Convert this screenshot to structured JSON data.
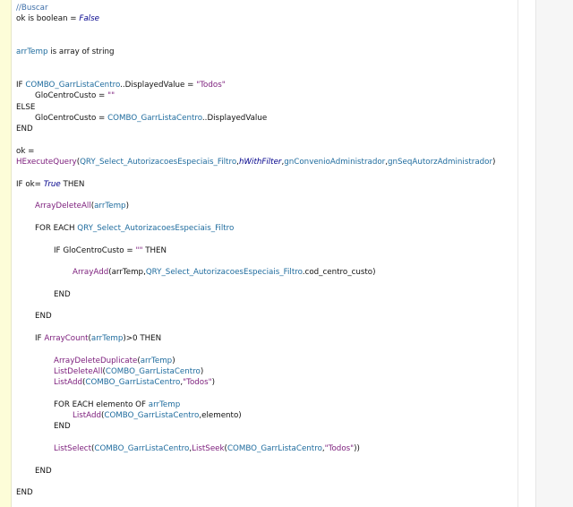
{
  "colors": {
    "keyword": "#1a1a1a",
    "comment": "#3d6ea8",
    "boolean": "#00008b",
    "function": "#7b1c7b",
    "control": "#1f6c9e",
    "string": "#7b1c7b",
    "default": "#111111"
  },
  "code_lines": [
    {
      "row": 0,
      "indent": 0,
      "tokens": [
        {
          "t": "//Buscar",
          "c": "comment"
        }
      ]
    },
    {
      "row": 1,
      "indent": 0,
      "tokens": [
        {
          "t": "ok is boolean = ",
          "c": "default"
        },
        {
          "t": "False",
          "c": "boolean",
          "i": true
        }
      ]
    },
    {
      "row": 4,
      "indent": 0,
      "tokens": [
        {
          "t": "arrTemp",
          "c": "control"
        },
        {
          "t": " is array of string",
          "c": "default"
        }
      ]
    },
    {
      "row": 7,
      "indent": 0,
      "tokens": [
        {
          "t": "IF ",
          "c": "default"
        },
        {
          "t": "COMBO_GarrListaCentro",
          "c": "control"
        },
        {
          "t": "..DisplayedValue = ",
          "c": "default"
        },
        {
          "t": "\"Todos\"",
          "c": "string"
        }
      ]
    },
    {
      "row": 8,
      "indent": 1,
      "tokens": [
        {
          "t": "GloCentroCusto = ",
          "c": "default"
        },
        {
          "t": "\"\"",
          "c": "string"
        }
      ]
    },
    {
      "row": 9,
      "indent": 0,
      "tokens": [
        {
          "t": "ELSE",
          "c": "default"
        }
      ]
    },
    {
      "row": 10,
      "indent": 1,
      "tokens": [
        {
          "t": "GloCentroCusto = ",
          "c": "default"
        },
        {
          "t": "COMBO_GarrListaCentro",
          "c": "control"
        },
        {
          "t": "..DisplayedValue",
          "c": "default"
        }
      ]
    },
    {
      "row": 11,
      "indent": 0,
      "tokens": [
        {
          "t": "END",
          "c": "default"
        }
      ]
    },
    {
      "row": 13,
      "indent": 0,
      "tokens": [
        {
          "t": "ok =",
          "c": "default"
        }
      ]
    },
    {
      "row": 14,
      "indent": 0,
      "tokens": [
        {
          "t": "HExecuteQuery",
          "c": "function"
        },
        {
          "t": "(",
          "c": "default"
        },
        {
          "t": "QRY_Select_AutorizacoesEspeciais_Filtro",
          "c": "control"
        },
        {
          "t": ",",
          "c": "default"
        },
        {
          "t": "hWithFilter",
          "c": "boolean",
          "i": true
        },
        {
          "t": ",",
          "c": "default"
        },
        {
          "t": "gnConvenioAdministrador",
          "c": "control"
        },
        {
          "t": ",",
          "c": "default"
        },
        {
          "t": "gnSeqAutorzAdministrador",
          "c": "control"
        },
        {
          "t": ")",
          "c": "default"
        }
      ]
    },
    {
      "row": 16,
      "indent": 0,
      "tokens": [
        {
          "t": "IF ok= ",
          "c": "default"
        },
        {
          "t": "True",
          "c": "boolean",
          "i": true
        },
        {
          "t": " THEN",
          "c": "default"
        }
      ]
    },
    {
      "row": 18,
      "indent": 1,
      "tokens": [
        {
          "t": "ArrayDeleteAll",
          "c": "function"
        },
        {
          "t": "(",
          "c": "default"
        },
        {
          "t": "arrTemp",
          "c": "control"
        },
        {
          "t": ")",
          "c": "default"
        }
      ]
    },
    {
      "row": 20,
      "indent": 1,
      "tokens": [
        {
          "t": "FOR EACH ",
          "c": "default"
        },
        {
          "t": "QRY_Select_AutorizacoesEspeciais_Filtro",
          "c": "control"
        }
      ]
    },
    {
      "row": 22,
      "indent": 2,
      "tokens": [
        {
          "t": "IF ",
          "c": "default"
        },
        {
          "t": "GloCentroCusto",
          "c": "default"
        },
        {
          "t": " = ",
          "c": "default"
        },
        {
          "t": "\"\"",
          "c": "string"
        },
        {
          "t": " THEN",
          "c": "default"
        }
      ]
    },
    {
      "row": 24,
      "indent": 3,
      "tokens": [
        {
          "t": "ArrayAdd",
          "c": "function"
        },
        {
          "t": "(",
          "c": "default"
        },
        {
          "t": "arrTemp",
          "c": "default"
        },
        {
          "t": ",",
          "c": "default"
        },
        {
          "t": "QRY_Select_AutorizacoesEspeciais_Filtro",
          "c": "control"
        },
        {
          "t": ".cod_centro_custo)",
          "c": "default"
        }
      ]
    },
    {
      "row": 26,
      "indent": 2,
      "tokens": [
        {
          "t": "END",
          "c": "default"
        }
      ]
    },
    {
      "row": 28,
      "indent": 1,
      "tokens": [
        {
          "t": "END",
          "c": "default"
        }
      ]
    },
    {
      "row": 30,
      "indent": 1,
      "tokens": [
        {
          "t": "IF ",
          "c": "default"
        },
        {
          "t": "ArrayCount",
          "c": "function"
        },
        {
          "t": "(",
          "c": "default"
        },
        {
          "t": "arrTemp",
          "c": "control"
        },
        {
          "t": ")>0 THEN",
          "c": "default"
        }
      ]
    },
    {
      "row": 32,
      "indent": 2,
      "tokens": [
        {
          "t": "ArrayDeleteDuplicate",
          "c": "function"
        },
        {
          "t": "(",
          "c": "default"
        },
        {
          "t": "arrTemp",
          "c": "control"
        },
        {
          "t": ")",
          "c": "default"
        }
      ]
    },
    {
      "row": 33,
      "indent": 2,
      "tokens": [
        {
          "t": "ListDeleteAll",
          "c": "function"
        },
        {
          "t": "(",
          "c": "default"
        },
        {
          "t": "COMBO_GarrListaCentro",
          "c": "control"
        },
        {
          "t": ")",
          "c": "default"
        }
      ]
    },
    {
      "row": 34,
      "indent": 2,
      "tokens": [
        {
          "t": "ListAdd",
          "c": "function"
        },
        {
          "t": "(",
          "c": "default"
        },
        {
          "t": "COMBO_GarrListaCentro",
          "c": "control"
        },
        {
          "t": ",",
          "c": "default"
        },
        {
          "t": "\"Todos\"",
          "c": "string"
        },
        {
          "t": ")",
          "c": "default"
        }
      ]
    },
    {
      "row": 36,
      "indent": 2,
      "tokens": [
        {
          "t": "FOR EACH elemento OF ",
          "c": "default"
        },
        {
          "t": "arrTemp",
          "c": "control"
        }
      ]
    },
    {
      "row": 37,
      "indent": 3,
      "tokens": [
        {
          "t": "ListAdd",
          "c": "function"
        },
        {
          "t": "(",
          "c": "default"
        },
        {
          "t": "COMBO_GarrListaCentro",
          "c": "control"
        },
        {
          "t": ",elemento)",
          "c": "default"
        }
      ]
    },
    {
      "row": 38,
      "indent": 2,
      "tokens": [
        {
          "t": "END",
          "c": "default"
        }
      ]
    },
    {
      "row": 40,
      "indent": 2,
      "tokens": [
        {
          "t": "ListSelect",
          "c": "function"
        },
        {
          "t": "(",
          "c": "default"
        },
        {
          "t": "COMBO_GarrListaCentro",
          "c": "control"
        },
        {
          "t": ",",
          "c": "default"
        },
        {
          "t": "ListSeek",
          "c": "function"
        },
        {
          "t": "(",
          "c": "default"
        },
        {
          "t": "COMBO_GarrListaCentro",
          "c": "control"
        },
        {
          "t": ",",
          "c": "default"
        },
        {
          "t": "\"Todos\"",
          "c": "string"
        },
        {
          "t": "))",
          "c": "default"
        }
      ]
    },
    {
      "row": 42,
      "indent": 1,
      "tokens": [
        {
          "t": "END",
          "c": "default"
        }
      ]
    },
    {
      "row": 44,
      "indent": 0,
      "tokens": [
        {
          "t": "END",
          "c": "default"
        }
      ]
    }
  ]
}
